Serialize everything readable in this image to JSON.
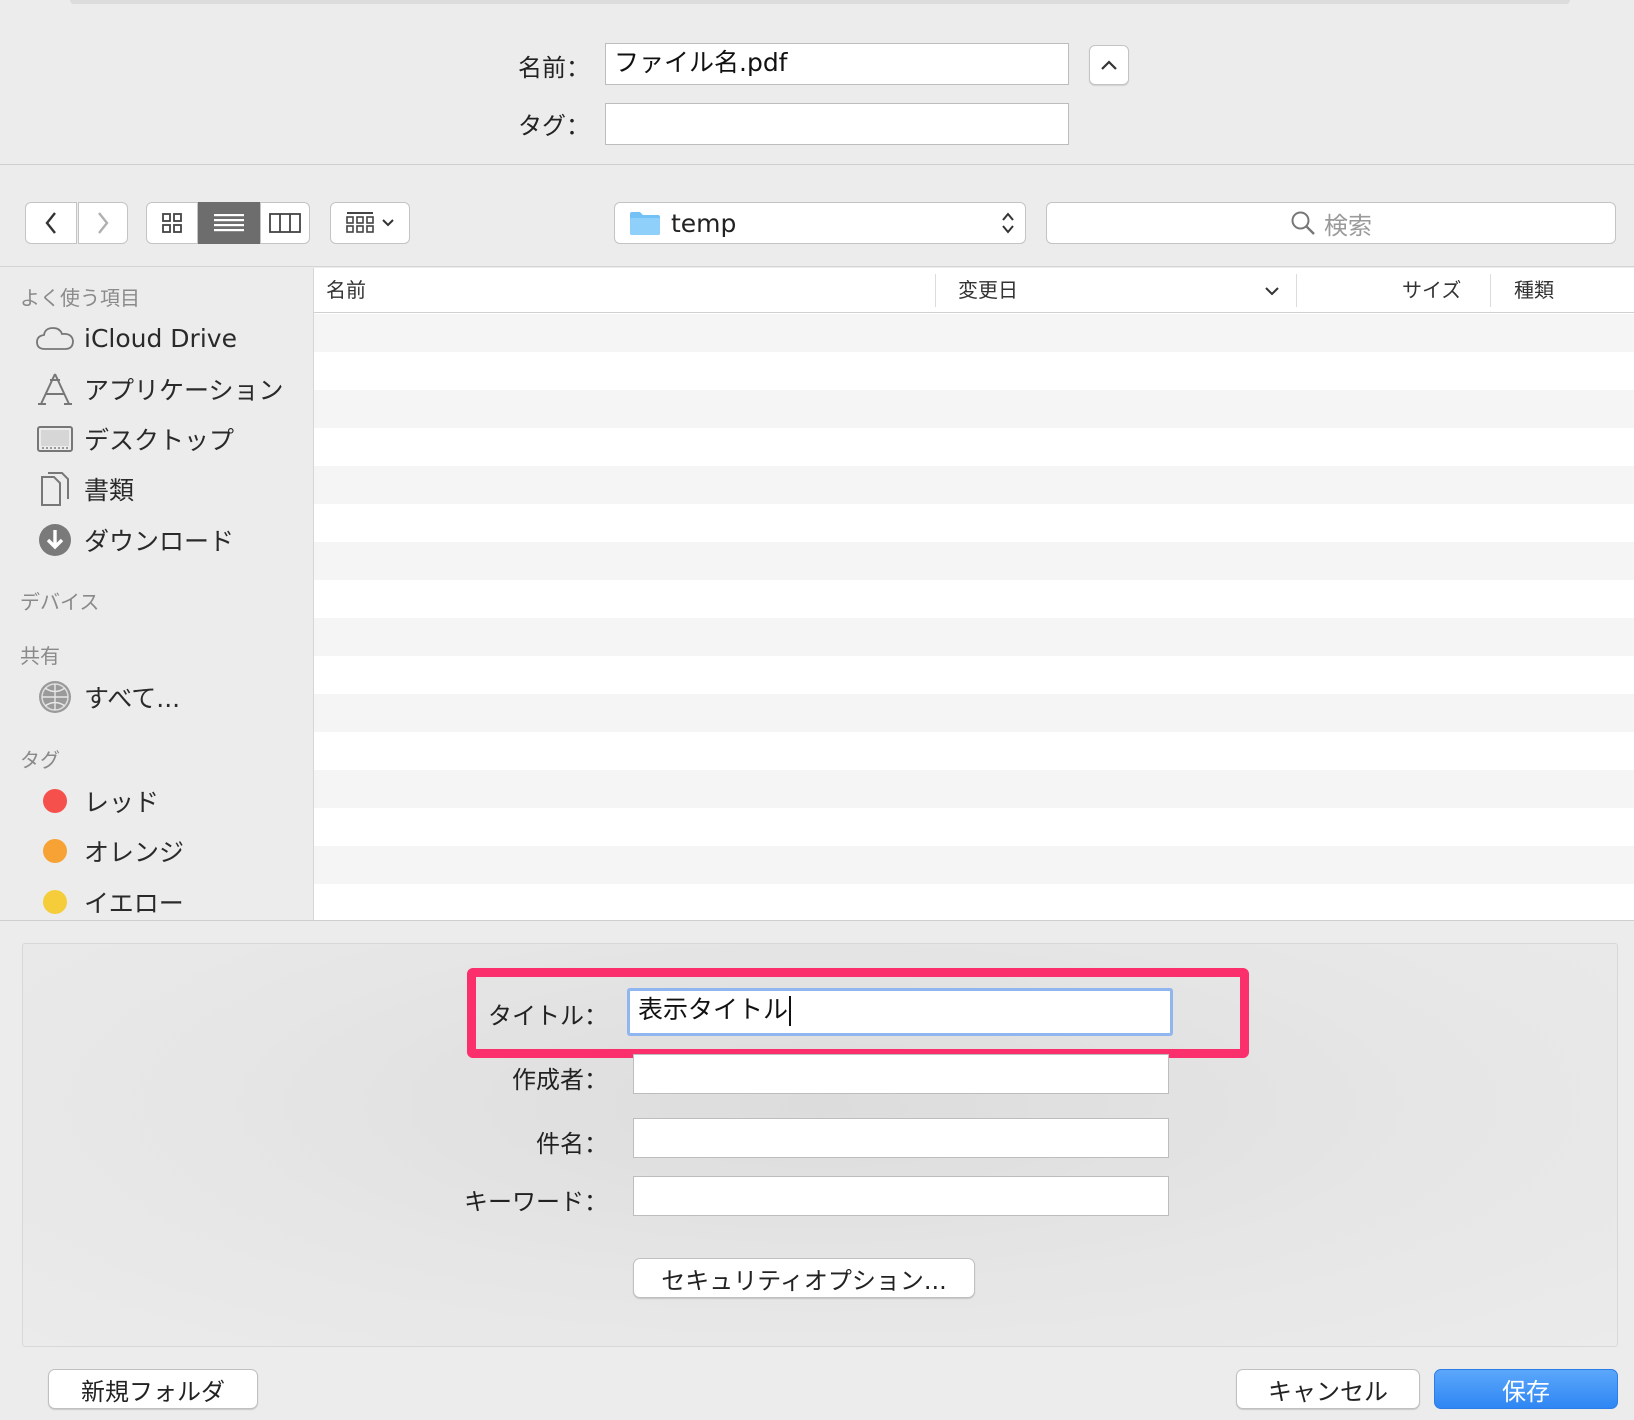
{
  "top": {
    "name_label": "名前：",
    "name_value": "ファイル名.pdf",
    "tag_label": "タグ：",
    "tag_value": ""
  },
  "toolbar": {
    "location": "temp",
    "search_placeholder": "検索"
  },
  "sidebar": {
    "sections": [
      {
        "heading": "よく使う項目",
        "items": [
          {
            "label": "iCloud Drive",
            "icon": "cloud-icon"
          },
          {
            "label": "アプリケーション",
            "icon": "applications-icon"
          },
          {
            "label": "デスクトップ",
            "icon": "desktop-icon"
          },
          {
            "label": "書類",
            "icon": "documents-icon"
          },
          {
            "label": "ダウンロード",
            "icon": "download-icon"
          }
        ]
      },
      {
        "heading": "デバイス",
        "items": []
      },
      {
        "heading": "共有",
        "items": [
          {
            "label": "すべて...",
            "icon": "network-icon"
          }
        ]
      },
      {
        "heading": "タグ",
        "items": [
          {
            "label": "レッド",
            "color": "#f5504c"
          },
          {
            "label": "オレンジ",
            "color": "#f7a234"
          },
          {
            "label": "イエロー",
            "color": "#f5cd3a"
          }
        ]
      }
    ]
  },
  "file_list": {
    "columns": [
      "名前",
      "変更日",
      "サイズ",
      "種類"
    ]
  },
  "options": {
    "title_label": "タイトル：",
    "title_value": "表示タイトル",
    "author_label": "作成者：",
    "author_value": "",
    "subject_label": "件名：",
    "subject_value": "",
    "keywords_label": "キーワード：",
    "keywords_value": "",
    "security_button": "セキュリティオプション..."
  },
  "footer": {
    "new_folder": "新規フォルダ",
    "cancel": "キャンセル",
    "save": "保存"
  },
  "colors": {
    "highlight": "#fa2f6c",
    "save_button": "#2f86f3",
    "focus_ring": "#8fb6ee"
  }
}
